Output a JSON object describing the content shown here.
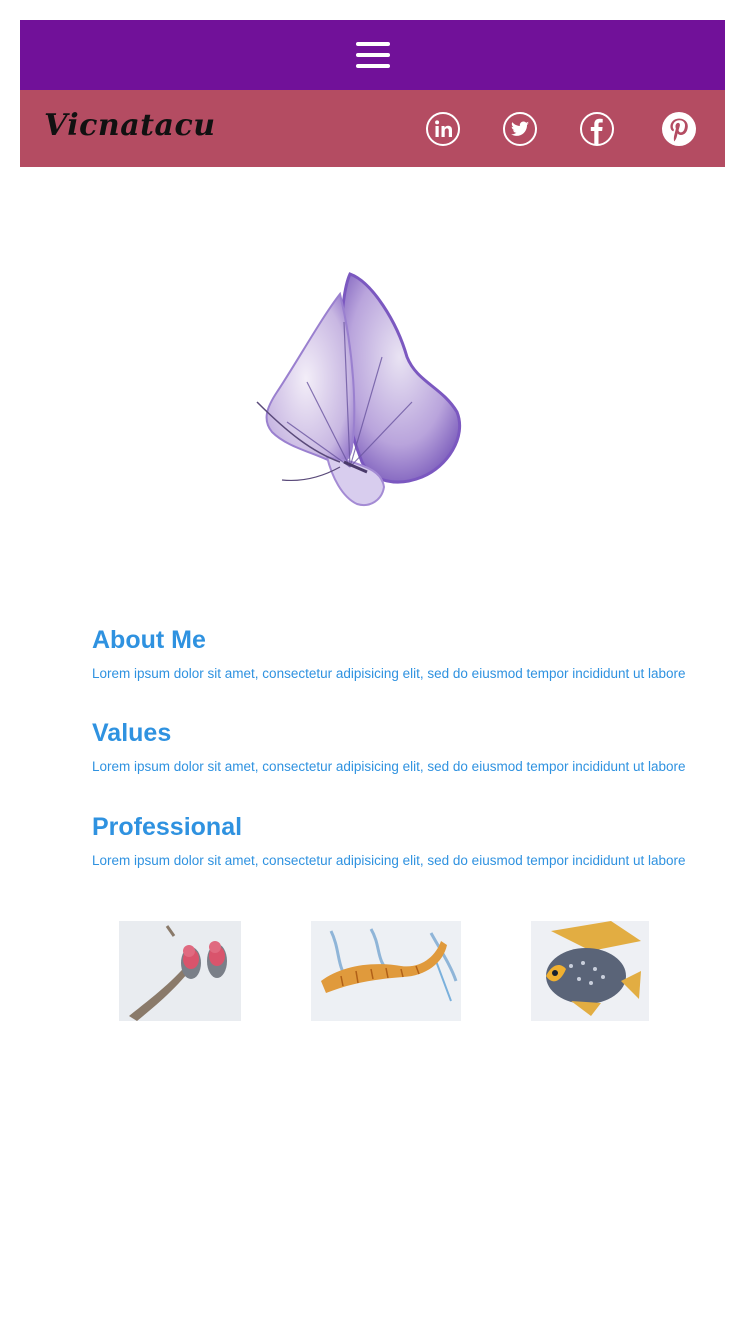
{
  "nav": {
    "menu_icon": "hamburger-menu-icon",
    "bar_color": "#711199"
  },
  "brand": {
    "logo_text": "Vicnatacu",
    "bar_color": "#b44c62"
  },
  "social": [
    {
      "name": "linkedin",
      "icon": "linkedin-icon"
    },
    {
      "name": "twitter",
      "icon": "twitter-icon"
    },
    {
      "name": "facebook",
      "icon": "facebook-icon"
    },
    {
      "name": "pinterest",
      "icon": "pinterest-icon"
    }
  ],
  "hero": {
    "image": "purple-butterfly-image"
  },
  "sections": [
    {
      "title": "About Me",
      "text": "Lorem ipsum dolor sit amet, consectetur adipisicing elit, sed do eiusmod tempor incididunt ut labore"
    },
    {
      "title": "Values",
      "text": "Lorem ipsum dolor sit amet, consectetur adipisicing elit, sed do eiusmod tempor incididunt ut labore"
    },
    {
      "title": "Professional",
      "text": "Lorem ipsum dolor sit amet, consectetur adipisicing elit, sed do eiusmod tempor incididunt ut labore"
    }
  ],
  "gallery": [
    {
      "image": "parrots-drawing"
    },
    {
      "image": "seahorse-drawing"
    },
    {
      "image": "fish-drawing"
    }
  ],
  "colors": {
    "accent_text": "#2f92e0"
  }
}
